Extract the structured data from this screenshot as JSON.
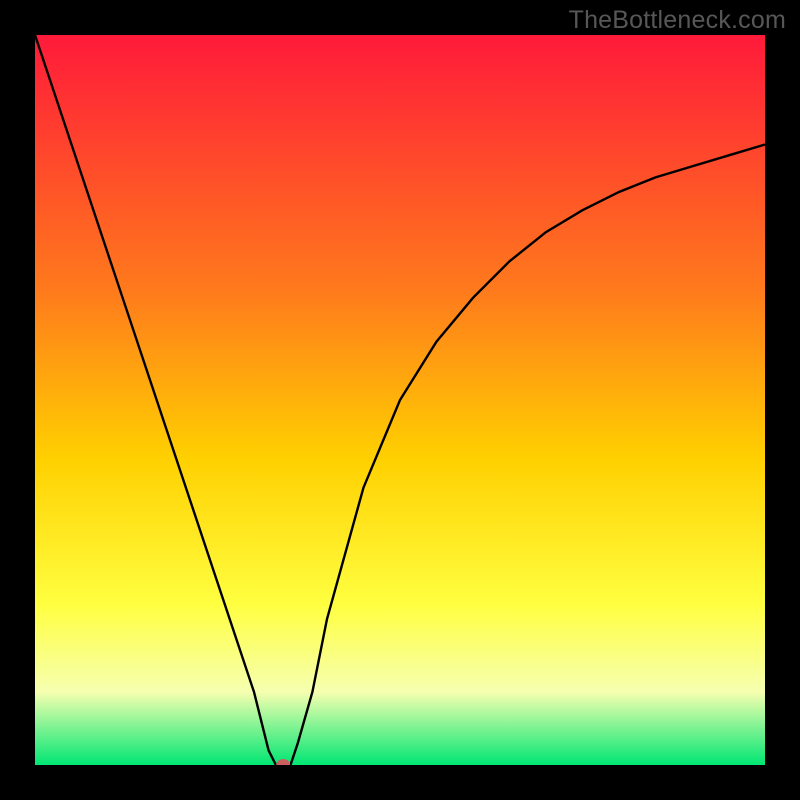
{
  "watermark": "TheBottleneck.com",
  "colors": {
    "frame": "#000000",
    "gradient_top": "#ff1a3a",
    "gradient_mid1": "#ff7a1c",
    "gradient_mid2": "#ffd000",
    "gradient_mid3": "#ffff40",
    "gradient_mid4": "#f6ffb0",
    "gradient_bottom": "#00e673",
    "curve": "#000000",
    "marker": "#c9605f"
  },
  "chart_data": {
    "type": "line",
    "title": "",
    "xlabel": "",
    "ylabel": "",
    "xlim": [
      0,
      100
    ],
    "ylim": [
      0,
      100
    ],
    "grid": false,
    "series": [
      {
        "name": "bottleneck-curve",
        "x": [
          0,
          5,
          10,
          15,
          20,
          25,
          30,
          32,
          33,
          34,
          35,
          36,
          38,
          40,
          45,
          50,
          55,
          60,
          65,
          70,
          75,
          80,
          85,
          90,
          95,
          100
        ],
        "values": [
          100,
          85,
          70,
          55,
          40,
          25,
          10,
          2,
          0,
          0,
          0,
          3,
          10,
          20,
          38,
          50,
          58,
          64,
          69,
          73,
          76,
          78.5,
          80.5,
          82,
          83.5,
          85
        ]
      }
    ],
    "annotations": [
      {
        "name": "optimum-marker",
        "x": 34,
        "y": 0
      }
    ]
  }
}
